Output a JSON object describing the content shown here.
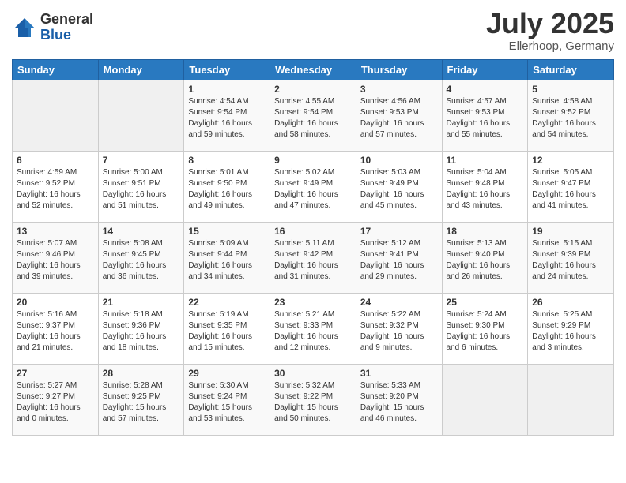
{
  "logo": {
    "general": "General",
    "blue": "Blue"
  },
  "header": {
    "month": "July 2025",
    "location": "Ellerhoop, Germany"
  },
  "weekdays": [
    "Sunday",
    "Monday",
    "Tuesday",
    "Wednesday",
    "Thursday",
    "Friday",
    "Saturday"
  ],
  "weeks": [
    [
      {
        "day": "",
        "info": ""
      },
      {
        "day": "",
        "info": ""
      },
      {
        "day": "1",
        "info": "Sunrise: 4:54 AM\nSunset: 9:54 PM\nDaylight: 16 hours\nand 59 minutes."
      },
      {
        "day": "2",
        "info": "Sunrise: 4:55 AM\nSunset: 9:54 PM\nDaylight: 16 hours\nand 58 minutes."
      },
      {
        "day": "3",
        "info": "Sunrise: 4:56 AM\nSunset: 9:53 PM\nDaylight: 16 hours\nand 57 minutes."
      },
      {
        "day": "4",
        "info": "Sunrise: 4:57 AM\nSunset: 9:53 PM\nDaylight: 16 hours\nand 55 minutes."
      },
      {
        "day": "5",
        "info": "Sunrise: 4:58 AM\nSunset: 9:52 PM\nDaylight: 16 hours\nand 54 minutes."
      }
    ],
    [
      {
        "day": "6",
        "info": "Sunrise: 4:59 AM\nSunset: 9:52 PM\nDaylight: 16 hours\nand 52 minutes."
      },
      {
        "day": "7",
        "info": "Sunrise: 5:00 AM\nSunset: 9:51 PM\nDaylight: 16 hours\nand 51 minutes."
      },
      {
        "day": "8",
        "info": "Sunrise: 5:01 AM\nSunset: 9:50 PM\nDaylight: 16 hours\nand 49 minutes."
      },
      {
        "day": "9",
        "info": "Sunrise: 5:02 AM\nSunset: 9:49 PM\nDaylight: 16 hours\nand 47 minutes."
      },
      {
        "day": "10",
        "info": "Sunrise: 5:03 AM\nSunset: 9:49 PM\nDaylight: 16 hours\nand 45 minutes."
      },
      {
        "day": "11",
        "info": "Sunrise: 5:04 AM\nSunset: 9:48 PM\nDaylight: 16 hours\nand 43 minutes."
      },
      {
        "day": "12",
        "info": "Sunrise: 5:05 AM\nSunset: 9:47 PM\nDaylight: 16 hours\nand 41 minutes."
      }
    ],
    [
      {
        "day": "13",
        "info": "Sunrise: 5:07 AM\nSunset: 9:46 PM\nDaylight: 16 hours\nand 39 minutes."
      },
      {
        "day": "14",
        "info": "Sunrise: 5:08 AM\nSunset: 9:45 PM\nDaylight: 16 hours\nand 36 minutes."
      },
      {
        "day": "15",
        "info": "Sunrise: 5:09 AM\nSunset: 9:44 PM\nDaylight: 16 hours\nand 34 minutes."
      },
      {
        "day": "16",
        "info": "Sunrise: 5:11 AM\nSunset: 9:42 PM\nDaylight: 16 hours\nand 31 minutes."
      },
      {
        "day": "17",
        "info": "Sunrise: 5:12 AM\nSunset: 9:41 PM\nDaylight: 16 hours\nand 29 minutes."
      },
      {
        "day": "18",
        "info": "Sunrise: 5:13 AM\nSunset: 9:40 PM\nDaylight: 16 hours\nand 26 minutes."
      },
      {
        "day": "19",
        "info": "Sunrise: 5:15 AM\nSunset: 9:39 PM\nDaylight: 16 hours\nand 24 minutes."
      }
    ],
    [
      {
        "day": "20",
        "info": "Sunrise: 5:16 AM\nSunset: 9:37 PM\nDaylight: 16 hours\nand 21 minutes."
      },
      {
        "day": "21",
        "info": "Sunrise: 5:18 AM\nSunset: 9:36 PM\nDaylight: 16 hours\nand 18 minutes."
      },
      {
        "day": "22",
        "info": "Sunrise: 5:19 AM\nSunset: 9:35 PM\nDaylight: 16 hours\nand 15 minutes."
      },
      {
        "day": "23",
        "info": "Sunrise: 5:21 AM\nSunset: 9:33 PM\nDaylight: 16 hours\nand 12 minutes."
      },
      {
        "day": "24",
        "info": "Sunrise: 5:22 AM\nSunset: 9:32 PM\nDaylight: 16 hours\nand 9 minutes."
      },
      {
        "day": "25",
        "info": "Sunrise: 5:24 AM\nSunset: 9:30 PM\nDaylight: 16 hours\nand 6 minutes."
      },
      {
        "day": "26",
        "info": "Sunrise: 5:25 AM\nSunset: 9:29 PM\nDaylight: 16 hours\nand 3 minutes."
      }
    ],
    [
      {
        "day": "27",
        "info": "Sunrise: 5:27 AM\nSunset: 9:27 PM\nDaylight: 16 hours\nand 0 minutes."
      },
      {
        "day": "28",
        "info": "Sunrise: 5:28 AM\nSunset: 9:25 PM\nDaylight: 15 hours\nand 57 minutes."
      },
      {
        "day": "29",
        "info": "Sunrise: 5:30 AM\nSunset: 9:24 PM\nDaylight: 15 hours\nand 53 minutes."
      },
      {
        "day": "30",
        "info": "Sunrise: 5:32 AM\nSunset: 9:22 PM\nDaylight: 15 hours\nand 50 minutes."
      },
      {
        "day": "31",
        "info": "Sunrise: 5:33 AM\nSunset: 9:20 PM\nDaylight: 15 hours\nand 46 minutes."
      },
      {
        "day": "",
        "info": ""
      },
      {
        "day": "",
        "info": ""
      }
    ]
  ]
}
